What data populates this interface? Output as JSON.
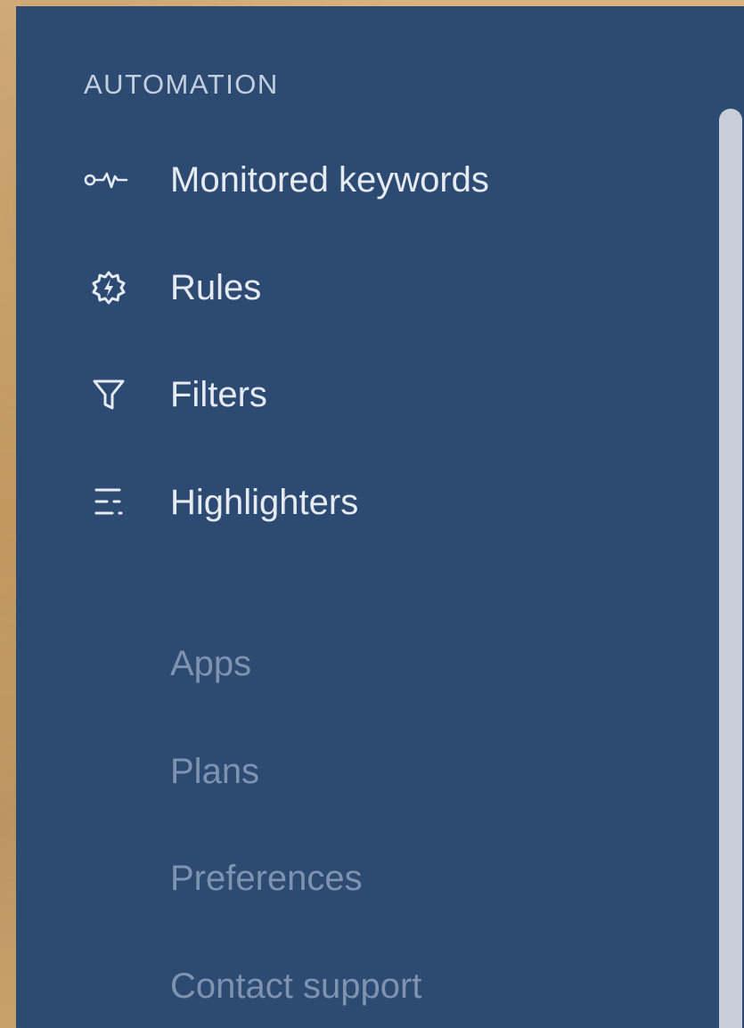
{
  "sidebar": {
    "section_heading": "AUTOMATION",
    "items": [
      {
        "label": "Monitored keywords",
        "icon": "pulse-monitor-icon"
      },
      {
        "label": "Rules",
        "icon": "rule-gear-icon"
      },
      {
        "label": "Filters",
        "icon": "filter-funnel-icon"
      },
      {
        "label": "Highlighters",
        "icon": "highlighter-lines-icon"
      }
    ],
    "secondary_items": [
      {
        "label": "Apps"
      },
      {
        "label": "Plans"
      },
      {
        "label": "Preferences"
      },
      {
        "label": "Contact support"
      }
    ]
  },
  "colors": {
    "panel_background": "#2c4a72",
    "primary_text": "#e6ebf2",
    "muted_text": "#7f93b0",
    "scrollbar": "#c9cfd8"
  }
}
